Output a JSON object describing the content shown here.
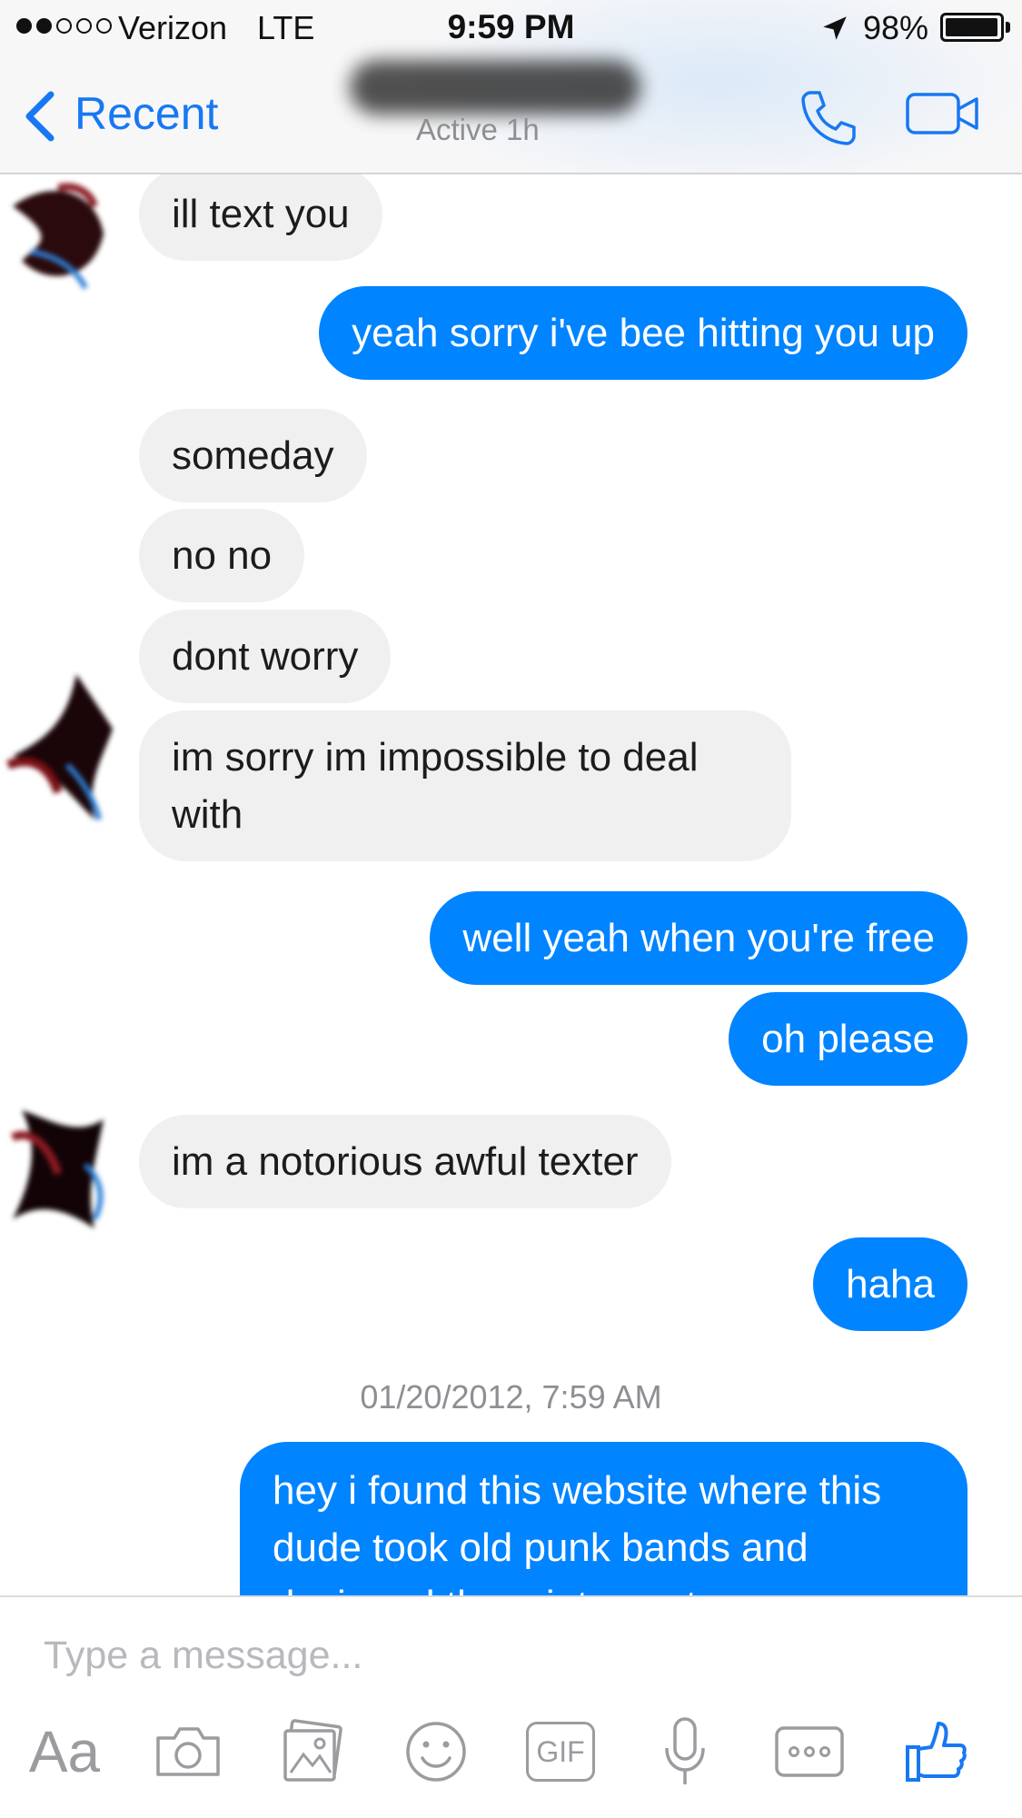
{
  "status_bar": {
    "carrier": "Verizon",
    "network": "LTE",
    "time": "9:59 PM",
    "battery_percent": "98%",
    "battery_level": 0.98,
    "signal_bars_filled": 2,
    "signal_bars_total": 5
  },
  "nav": {
    "back_label": "Recent",
    "contact_status": "Active 1h"
  },
  "messages": [
    {
      "direction": "incoming",
      "text": "ill text you"
    },
    {
      "direction": "outgoing",
      "text": "yeah sorry i've bee hitting you up"
    },
    {
      "direction": "incoming",
      "text": "someday"
    },
    {
      "direction": "incoming",
      "text": "no no"
    },
    {
      "direction": "incoming",
      "text": "dont worry"
    },
    {
      "direction": "incoming",
      "text": "im sorry im impossible to deal with"
    },
    {
      "direction": "outgoing",
      "text": "well yeah when you're free"
    },
    {
      "direction": "outgoing",
      "text": "oh please"
    },
    {
      "direction": "incoming",
      "text": "im a notorious awful texter"
    },
    {
      "direction": "outgoing",
      "text": "haha"
    },
    {
      "direction": "outgoing",
      "text": "hey i found this website where this dude took old punk bands and designed them into posters"
    }
  ],
  "timestamp": "01/20/2012, 7:59 AM",
  "composer": {
    "placeholder": "Type a message...",
    "aa_label": "Aa",
    "gif_label": "GIF"
  },
  "colors": {
    "accent": "#1778f2",
    "outgoing_bubble": "#0084ff",
    "incoming_bubble": "#f1f0f0",
    "muted": "#8e8e93",
    "toolbar_icon": "#9b9ba0"
  },
  "icons": [
    "location-arrow-icon",
    "chevron-left-icon",
    "phone-icon",
    "video-camera-icon",
    "camera-icon",
    "photo-gallery-icon",
    "smiley-icon",
    "gif-icon",
    "microphone-icon",
    "more-icon",
    "thumbs-up-icon"
  ]
}
